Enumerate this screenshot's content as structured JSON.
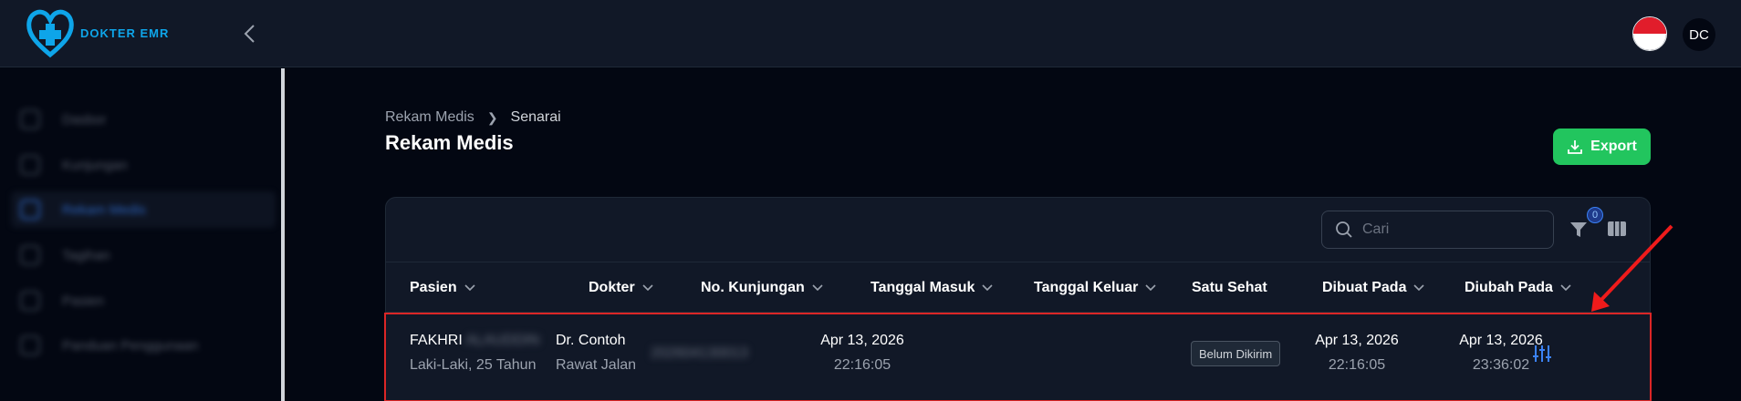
{
  "app": {
    "logo_text": "DOKTER EMR"
  },
  "user": {
    "initials": "DC",
    "language_flag": "id-flag-icon"
  },
  "sidebar": {
    "items": [
      {
        "label": "Dasbor",
        "icon": "home-icon",
        "active": false
      },
      {
        "label": "Kunjungan",
        "icon": "calendar-icon",
        "active": false
      },
      {
        "label": "Rekam Medis",
        "icon": "document-icon",
        "active": true
      },
      {
        "label": "Tagihan",
        "icon": "receipt-icon",
        "active": false
      },
      {
        "label": "Pasien",
        "icon": "user-icon",
        "active": false
      },
      {
        "label": "Panduan Penggunaan",
        "icon": "book-icon",
        "active": false
      }
    ]
  },
  "breadcrumb": {
    "parent": "Rekam Medis",
    "current": "Senarai"
  },
  "page": {
    "title": "Rekam Medis"
  },
  "toolbar": {
    "export_label": "Export",
    "search_placeholder": "Cari",
    "filter_count": "0"
  },
  "table": {
    "columns": [
      "Pasien",
      "Dokter",
      "No. Kunjungan",
      "Tanggal Masuk",
      "Tanggal Keluar",
      "Satu Sehat",
      "Dibuat Pada",
      "Diubah Pada"
    ],
    "rows": [
      {
        "patient_first": "FAKHRI",
        "patient_last_redacted": "ALAUDDIN",
        "patient_meta": "Laki-Laki, 25 Tahun",
        "doctor": "Dr. Contoh",
        "visit_type": "Rawat Jalan",
        "visit_no_redacted": "202604130013",
        "date_in": "Apr 13, 2026",
        "time_in": "22:16:05",
        "date_out": "",
        "satu_sehat": "Belum Dikirim",
        "created_date": "Apr 13, 2026",
        "created_time": "22:16:05",
        "updated_date": "Apr 13, 2026",
        "updated_time": "23:36:02"
      }
    ]
  },
  "colors": {
    "accent": "#3b82f6",
    "success": "#22c55e",
    "highlight": "#dc2626",
    "background": "#030712",
    "panel": "#111827"
  }
}
